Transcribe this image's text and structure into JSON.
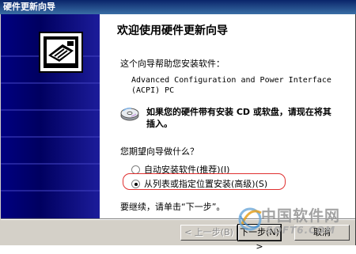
{
  "window": {
    "title": "硬件更新向导"
  },
  "wizard": {
    "heading": "欢迎使用硬件更新向导",
    "intro": "这个向导帮助您安装软件：",
    "device_line1": "Advanced Configuration and Power Interface",
    "device_line2": "(ACPI) PC",
    "cd_note": "如果您的硬件带有安装 CD 或软盘，请现在将其插入。",
    "question": "您期望向导做什么？",
    "options": [
      {
        "label": "自动安装软件(推荐)(I)",
        "checked": false
      },
      {
        "label": "从列表或指定位置安装(高级)(S)",
        "checked": true
      }
    ],
    "continue_note": "要继续，请单击“下一步”。"
  },
  "buttons": {
    "back": "< 上一步(B)",
    "next": "下一步(N) >",
    "cancel": "取消"
  },
  "watermark": {
    "line1": "中国软件网",
    "line2": "SOFT6.COM"
  },
  "colors": {
    "banner": "#000080",
    "titlebar": "#0a246a",
    "highlight": "#e03030"
  },
  "icons": {
    "banner": "hardware-card-icon",
    "cd": "cd-disk-icon",
    "watermark": "globe-logo-icon"
  }
}
